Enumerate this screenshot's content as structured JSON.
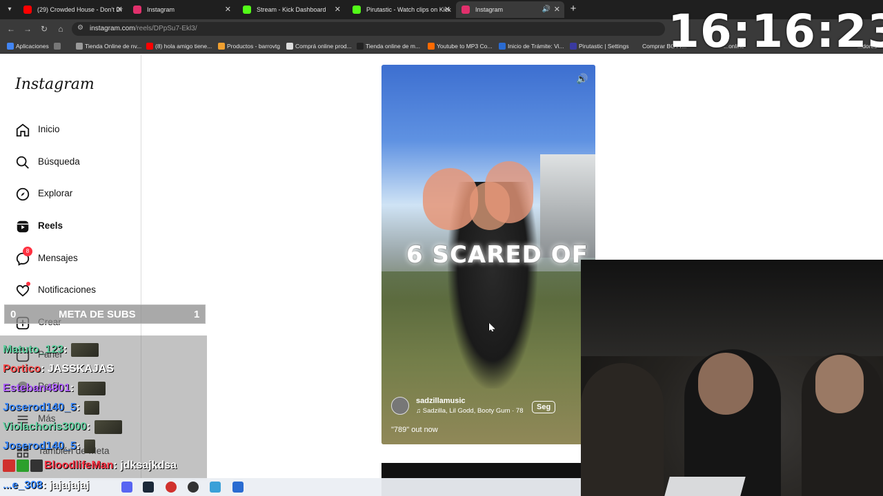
{
  "browser": {
    "tabs": [
      {
        "label": "(29) Crowded House - Don't Dr",
        "color": "#ff0000"
      },
      {
        "label": "Instagram",
        "color": "#e1306c"
      },
      {
        "label": "Stream - Kick Dashboard",
        "color": "#53fc18"
      },
      {
        "label": "Pirutastic - Watch clips on Kick",
        "color": "#53fc18"
      },
      {
        "label": "Instagram",
        "color": "#e1306c"
      }
    ],
    "new_tab_icon": "plus-icon",
    "url_host": "instagram.com",
    "url_path": "/reels/DPpSu7-Ekl3/",
    "bookmarks": [
      {
        "label": "Aplicaciones",
        "color": "#4285f4"
      },
      {
        "label": "Tienda Online de nv...",
        "color": "#999999"
      },
      {
        "label": "(8) hola amigo tiene...",
        "color": "#ff0000"
      },
      {
        "label": "Productos - barrovtg",
        "color": "#f0a030"
      },
      {
        "label": "Comprá online prod...",
        "color": "#dddddd"
      },
      {
        "label": "Tienda online de m...",
        "color": "#222222"
      },
      {
        "label": "Youtube to MP3 Co...",
        "color": "#ff6a00"
      },
      {
        "label": "Inicio de Trámite: Vi...",
        "color": "#2a6bd1"
      },
      {
        "label": "Pirutastic | Settings",
        "color": "#3a3aa0"
      },
      {
        "label": "Comprar BOTT...",
        "color": "#666666"
      },
      {
        "label": "...online",
        "color": "#666666"
      },
      {
        "label": "...dores",
        "color": "#666666"
      }
    ]
  },
  "clock": "16:16:23",
  "instagram": {
    "logo": "Instagram",
    "nav": [
      {
        "label": "Inicio",
        "icon": "home-icon"
      },
      {
        "label": "Búsqueda",
        "icon": "search-icon"
      },
      {
        "label": "Explorar",
        "icon": "compass-icon"
      },
      {
        "label": "Reels",
        "icon": "reels-icon"
      },
      {
        "label": "Mensajes",
        "icon": "messenger-icon",
        "badge": "8"
      },
      {
        "label": "Notificaciones",
        "icon": "heart-icon"
      },
      {
        "label": "Crear",
        "icon": "plus-square-icon"
      },
      {
        "label": "Panel",
        "icon": "dashboard-icon"
      },
      {
        "label": "Perfil",
        "icon": "profile-icon"
      },
      {
        "label": "Más",
        "icon": "menu-icon"
      },
      {
        "label": "También de Meta",
        "icon": "meta-icon"
      }
    ]
  },
  "reel": {
    "overlay_text": "6  SCARED OF",
    "username": "sadzillamusic",
    "music": "Sadzilla, Lil Godd, Booty Gum · 78",
    "follow_label": "Seg",
    "description": "\"789\" out now"
  },
  "stream_overlay": {
    "sub_goal_title": "META DE SUBS",
    "sub_goal_current": "0",
    "sub_goal_target": "1",
    "chat": [
      {
        "user": "Matuto_123",
        "message": "",
        "color": "#5fd0a0"
      },
      {
        "user": "Portico",
        "message": "JASSKAJAS",
        "color": "#ff4d4d"
      },
      {
        "user": "Esteban4801",
        "message": "",
        "color": "#b060ff"
      },
      {
        "user": "Joserod140_5",
        "message": "",
        "color": "#3d8bff"
      },
      {
        "user": "Violachoris3000",
        "message": "",
        "color": "#5fd0a0"
      },
      {
        "user": "Joserod140_5",
        "message": "",
        "color": "#3d8bff"
      },
      {
        "user": "BloodlifeMan",
        "message": "jdksajkdsa",
        "color": "#ff3344"
      },
      {
        "user": "...e_308",
        "message": "jajajajaj",
        "color": "#3d8bff"
      }
    ]
  },
  "taskbar": {
    "icons": [
      {
        "name": "start-icon",
        "color": "#2a6bd1"
      },
      {
        "name": "search-icon",
        "color": "#333333"
      },
      {
        "name": "discord-icon",
        "color": "#5865f2"
      },
      {
        "name": "steam-icon",
        "color": "#1b2838"
      },
      {
        "name": "record-icon",
        "color": "#d0312d"
      },
      {
        "name": "github-icon",
        "color": "#333333"
      },
      {
        "name": "app-icon",
        "color": "#3aa0d8"
      },
      {
        "name": "window-icon",
        "color": "#2a6bd1"
      }
    ]
  }
}
